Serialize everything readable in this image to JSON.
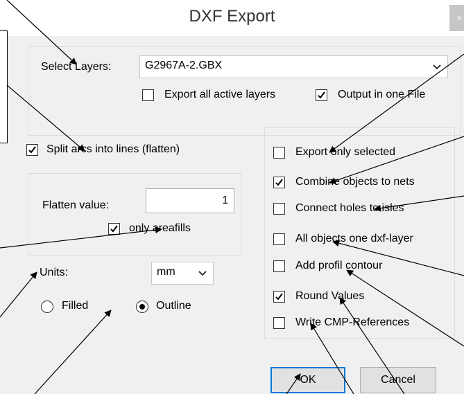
{
  "window": {
    "title": "DXF Export",
    "close_label": "×"
  },
  "layers": {
    "label": "Select Layers:",
    "selected": "G2967A-2.GBX",
    "export_all_active": {
      "label": "Export all active layers",
      "checked": false
    },
    "output_one_file": {
      "label": "Output in one File",
      "checked": true
    }
  },
  "split_arcs": {
    "label": "Split arcs into lines (flatten)",
    "checked": true
  },
  "flatten": {
    "label": "Flatten value:",
    "value": "1",
    "only_areafills": {
      "label": "only areafills",
      "checked": true
    }
  },
  "units": {
    "label": "Units:",
    "selected": "mm"
  },
  "fill_mode": {
    "filled_label": "Filled",
    "outline_label": "Outline",
    "selected": "Outline"
  },
  "options": [
    {
      "label": "Export only selected",
      "checked": false
    },
    {
      "label": "Combine objects to nets",
      "checked": true
    },
    {
      "label": "Connect holes to isles",
      "checked": false
    },
    {
      "label": "All objects one dxf-layer",
      "checked": false
    },
    {
      "label": "Add profil contour",
      "checked": false
    },
    {
      "label": "Round Values",
      "checked": true
    },
    {
      "label": "Write CMP-References",
      "checked": false
    }
  ],
  "buttons": {
    "ok": "OK",
    "cancel": "Cancel"
  },
  "colors": {
    "accent": "#0078d7",
    "dialog_bg": "#f0f0f0"
  },
  "icons": {
    "check": "check-icon",
    "chevron": "chevron-down-icon",
    "close": "close-icon"
  }
}
